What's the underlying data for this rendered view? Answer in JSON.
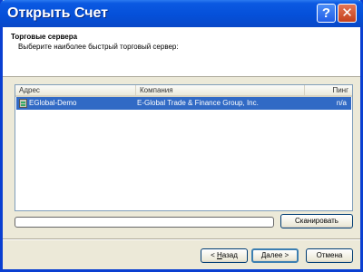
{
  "window": {
    "title": "Открыть Счет",
    "help_label": "?",
    "close_label": "✕"
  },
  "header": {
    "title": "Торговые сервера",
    "subtitle": "Выберите наиболее быстрый торговый сервер:"
  },
  "server_list": {
    "columns": [
      "Адрес",
      "Компания",
      "Пинг"
    ],
    "rows": [
      {
        "address": "EGlobal-Demo",
        "company": "E-Global Trade & Finance Group, Inc.",
        "ping": "n/a",
        "icon": "server-icon",
        "selected": true
      }
    ]
  },
  "scan": {
    "label": "Сканировать",
    "progress": 0
  },
  "buttons": {
    "back_prefix": "< ",
    "back_accel": "Н",
    "back_rest": "азад",
    "next_accel": "Д",
    "next_rest": "алее >",
    "cancel": "Отмена"
  },
  "colors": {
    "titlebar": "#0550d9",
    "selection": "#316ac5"
  }
}
